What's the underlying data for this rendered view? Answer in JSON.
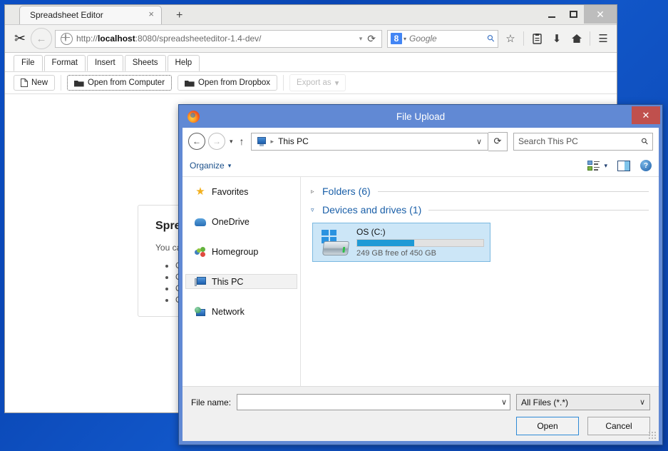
{
  "browser": {
    "tab": {
      "title": "Spreadsheet Editor",
      "close_glyph": "×"
    },
    "new_tab_glyph": "+",
    "window_controls": {
      "minimize": "",
      "maximize": "",
      "close": "✕"
    },
    "scissors_icon": "✂",
    "back_glyph": "←",
    "url": {
      "scheme": "http://",
      "host": "localhost",
      "rest": ":8080/spreadsheeteditor-1.4-dev/"
    },
    "url_dropdown_glyph": "▾",
    "reload_glyph": "⟳",
    "search": {
      "engine_letter": "8",
      "placeholder": "Google",
      "caret": "▾",
      "magnifier": "⚲"
    },
    "toolbar_icons": {
      "bookmark": "☆",
      "library": "὜b",
      "download": "⬇",
      "home": "⌂",
      "menu": "☰"
    }
  },
  "app": {
    "menu": [
      "File",
      "Format",
      "Insert",
      "Sheets",
      "Help"
    ],
    "toolbar": [
      {
        "label": "New",
        "icon": "὜b",
        "state": "normal"
      },
      {
        "label": "Open from Computer",
        "icon": "὜1",
        "state": "focused"
      },
      {
        "label": "Open from Dropbox",
        "icon": "὜1",
        "state": "normal"
      },
      {
        "label": "Export as",
        "icon": "",
        "state": "disabled"
      }
    ],
    "card": {
      "heading": "Spreadsheet Editor",
      "intro": "You can ...",
      "bullets": [
        "C",
        "O",
        "O",
        "O"
      ]
    }
  },
  "dialog": {
    "title": "File Upload",
    "app_icon": "firefox-icon",
    "close_glyph": "✕",
    "nav": {
      "back_glyph": "←",
      "forward_glyph": "→",
      "recent_caret": "▾",
      "up_glyph": "↑",
      "refresh_glyph": "⟳"
    },
    "breadcrumb": {
      "icon": "this-pc-icon",
      "separator": "▸",
      "path": "This PC",
      "dropdown": "∨"
    },
    "search": {
      "placeholder": "Search This PC",
      "magnifier": "⚲"
    },
    "organize": {
      "label": "Organize",
      "caret": "▾"
    },
    "view_controls": {
      "layout_caret": "▾",
      "preview_pane": "preview-pane-icon",
      "help": "?"
    },
    "sidebar": [
      {
        "label": "Favorites",
        "icon": "star-icon",
        "selected": false
      },
      {
        "label": "OneDrive",
        "icon": "cloud-icon",
        "selected": false
      },
      {
        "label": "Homegroup",
        "icon": "homegroup-icon",
        "selected": false
      },
      {
        "label": "This PC",
        "icon": "computer-icon",
        "selected": true
      },
      {
        "label": "Network",
        "icon": "network-icon",
        "selected": false
      }
    ],
    "groups": [
      {
        "title": "Folders (6)",
        "expanded": false,
        "triangle": "▹"
      },
      {
        "title": "Devices and drives (1)",
        "expanded": true,
        "triangle": "▿"
      }
    ],
    "drives": [
      {
        "name": "OS (C:)",
        "free_text": "249 GB free of 450 GB",
        "used_percent": 45,
        "icon": "windows-drive-icon",
        "selected": true
      }
    ],
    "footer": {
      "file_name_label": "File name:",
      "file_name_value": "",
      "file_name_dropdown": "∨",
      "filter_value": "All Files (*.*)",
      "filter_dropdown": "∨",
      "open_button": "Open",
      "cancel_button": "Cancel"
    }
  },
  "colors": {
    "dialog_frame": "#6189d4",
    "dialog_close": "#c0504d",
    "accent_blue": "#1a5fa8",
    "drive_bar_fill": "#1e9ad6",
    "selection_bg": "#cce6f7",
    "desktop": "#0a46b4"
  }
}
